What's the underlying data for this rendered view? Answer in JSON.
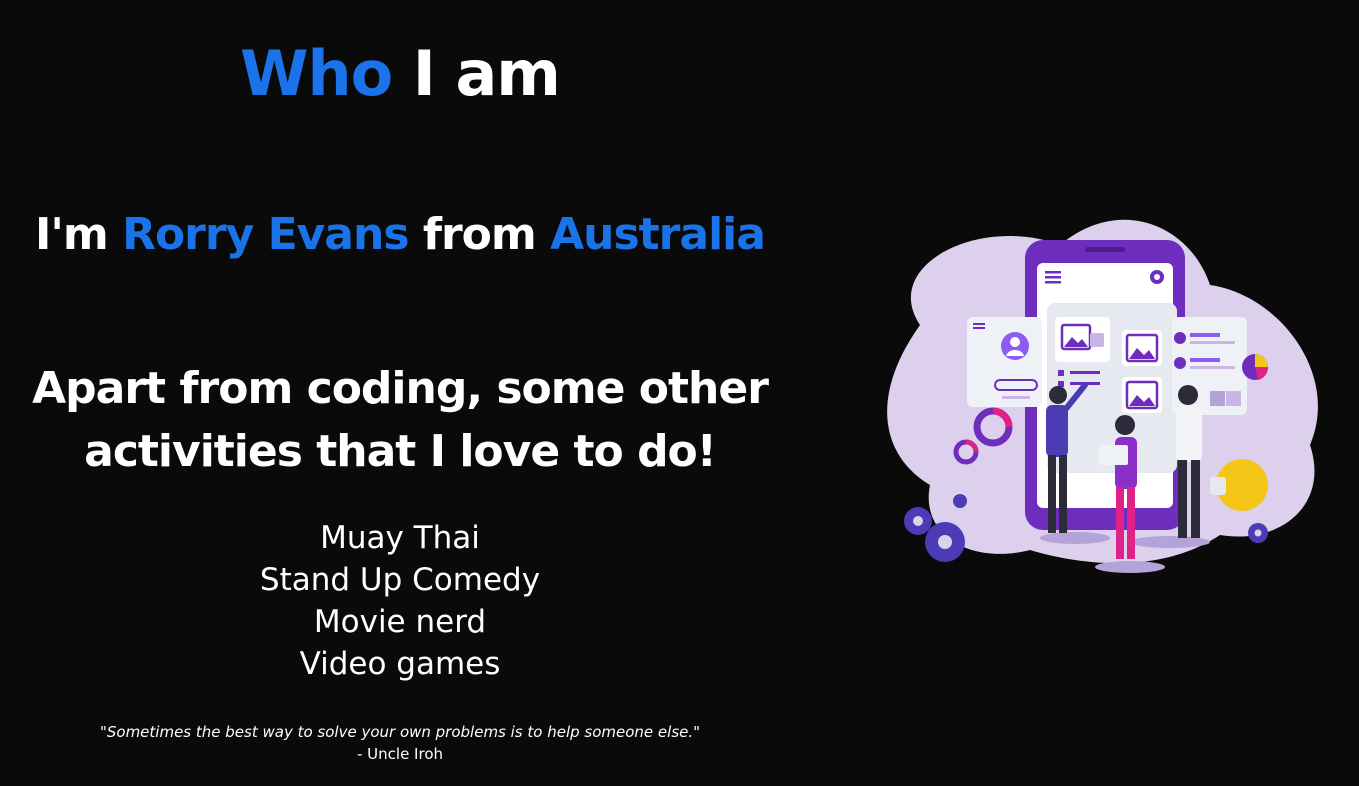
{
  "theme": {
    "accent": "#1a73e8",
    "background": "#0a0a0a",
    "text": "#ffffff"
  },
  "header": {
    "title_accent": "Who",
    "title_rest": " I am"
  },
  "intro": {
    "prefix": "I'm ",
    "name": "Rorry Evans",
    "middle": " from ",
    "country": "Australia"
  },
  "activities": {
    "heading_line1": "Apart from coding, some other",
    "heading_line2": "activities that I love to do!",
    "items": [
      "Muay Thai",
      "Stand Up Comedy",
      "Movie nerd",
      "Video games"
    ]
  },
  "quote": {
    "text": "\"Sometimes the best way to solve your own problems is to help someone else.\"",
    "author": "- Uncle Iroh"
  },
  "illustration": {
    "icon": "team-app-illustration"
  }
}
